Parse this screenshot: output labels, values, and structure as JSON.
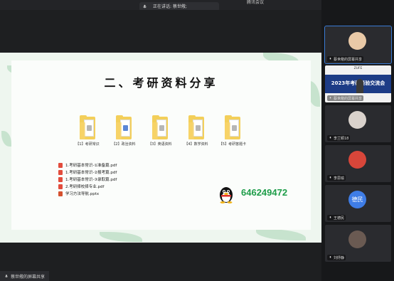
{
  "app": {
    "title": "腾讯会议"
  },
  "speaker": {
    "text": "正在讲话: 蔡世儆;"
  },
  "slide": {
    "title": "二、考研资料分享",
    "folders": [
      {
        "label": "【1】考研常识"
      },
      {
        "label": "【2】政治资料"
      },
      {
        "label": "【3】英语资料"
      },
      {
        "label": "【4】数学资料"
      },
      {
        "label": "【5】考研答题卡"
      }
    ],
    "files": [
      {
        "name": "1.考研基本常识-①准备篇.pdf",
        "type": "pdf"
      },
      {
        "name": "1.考研基本常识-②报考篇.pdf",
        "type": "pdf"
      },
      {
        "name": "1.考研基本常识-③录取篇.pdf",
        "type": "pdf"
      },
      {
        "name": "2.考研择校择专业.pdf",
        "type": "pdf"
      },
      {
        "name": "学习方法导航.pptx",
        "type": "pptx"
      }
    ],
    "qq_number": "646249472"
  },
  "share_status": {
    "text": "蔡世儆的屏幕共享"
  },
  "participants": [
    {
      "name": "蔡世儆的屏幕共享",
      "kind": "avatar",
      "active": true
    },
    {
      "name": "蔡世儆的屏幕共享",
      "kind": "slide",
      "slide_head": "ZUFE",
      "slide_title": "2023年考研经验交流会"
    },
    {
      "name": "李兰颖18",
      "kind": "avatar"
    },
    {
      "name": "李思瑜",
      "kind": "avatar"
    },
    {
      "name": "王德民",
      "kind": "letter",
      "letter": "德民"
    },
    {
      "name": "刘妤静",
      "kind": "avatar"
    }
  ],
  "colors": {
    "accent": "#3a7bd5",
    "qq_green": "#1e9d49",
    "folder": "#f3cf5a"
  }
}
